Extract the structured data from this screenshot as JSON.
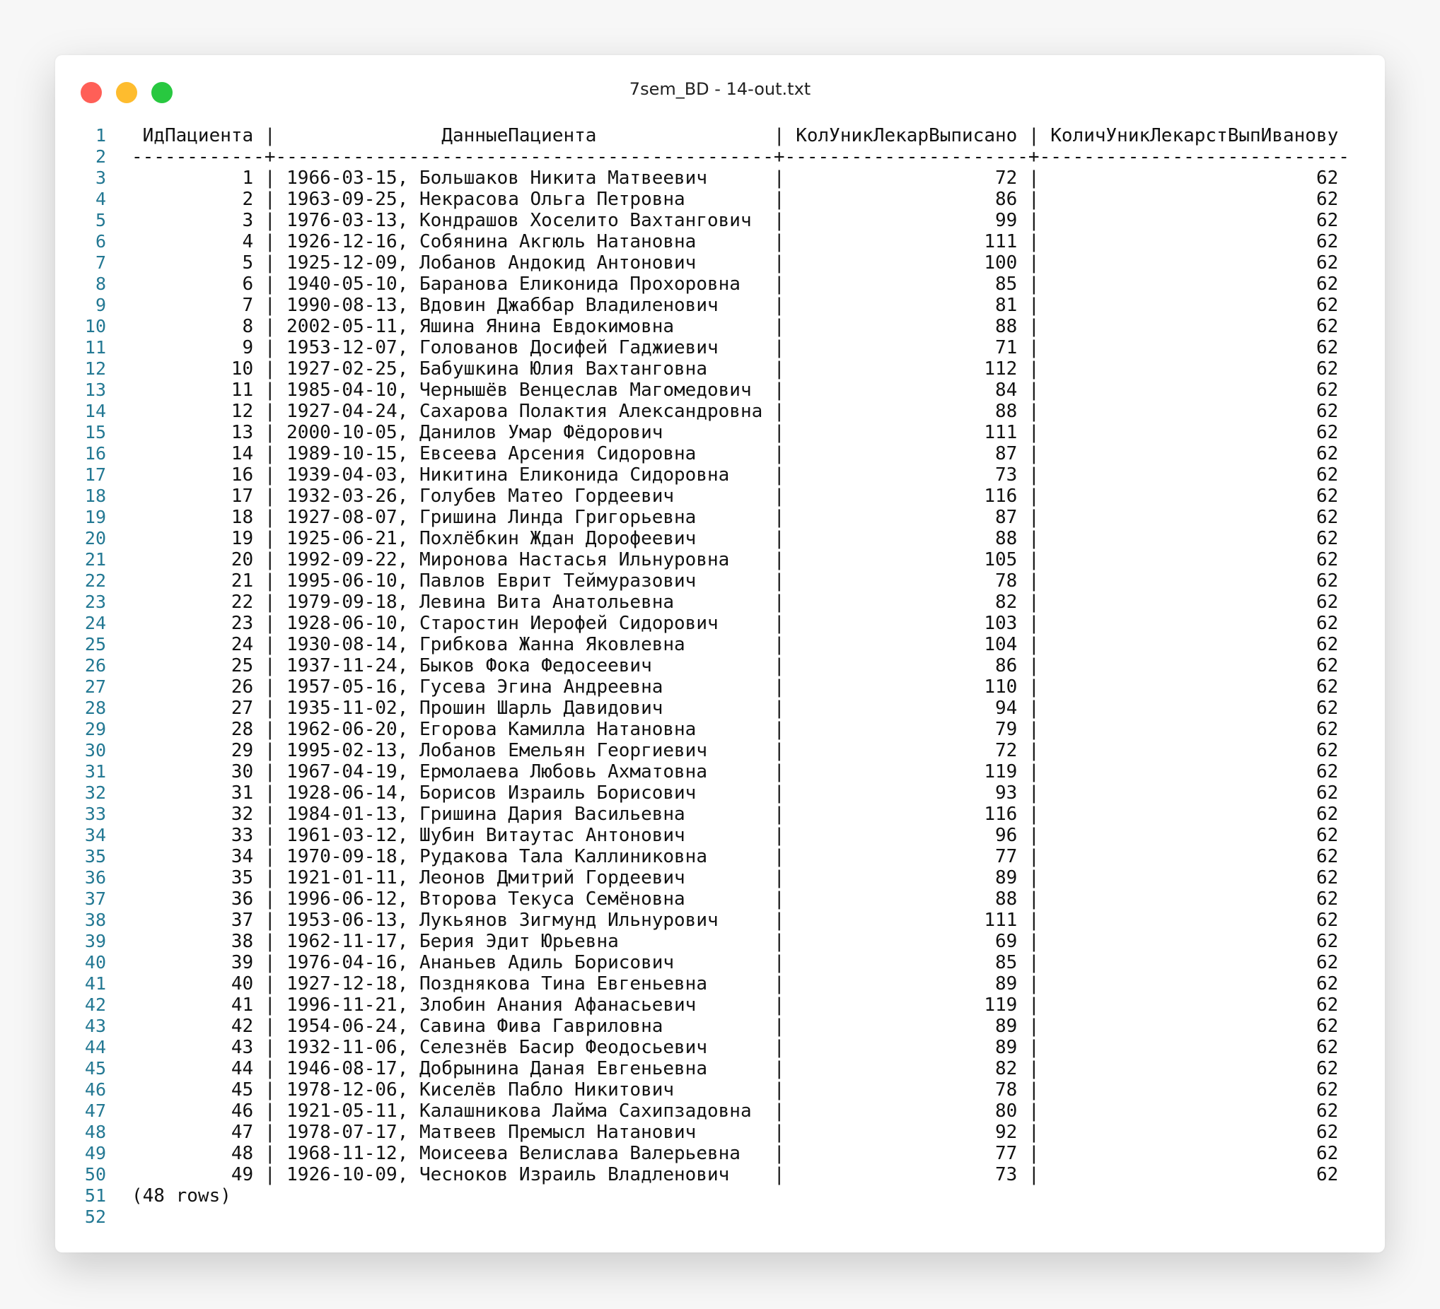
{
  "window": {
    "title": "7sem_BD - 14-out.txt",
    "buttons": {
      "close_color": "#ff5f57",
      "minimize_color": "#febc2e",
      "maximize_color": "#28c840"
    }
  },
  "editor": {
    "line_number_color": "#237893",
    "headers": [
      "ИдПациента",
      "ДанныеПациента",
      "КолУникЛекарВыписано",
      "КоличУникЛекарстВыпИванову"
    ],
    "rows": [
      [
        "1",
        "1966-03-15, Большаков Никита Матвеевич",
        "72",
        "62"
      ],
      [
        "2",
        "1963-09-25, Некрасова Ольга Петровна",
        "86",
        "62"
      ],
      [
        "3",
        "1976-03-13, Кондрашов Хоселито Вахтангович",
        "99",
        "62"
      ],
      [
        "4",
        "1926-12-16, Собянина Акгюль Натановна",
        "111",
        "62"
      ],
      [
        "5",
        "1925-12-09, Лобанов Андокид Антонович",
        "100",
        "62"
      ],
      [
        "6",
        "1940-05-10, Баранова Еликонида Прохоровна",
        "85",
        "62"
      ],
      [
        "7",
        "1990-08-13, Вдовин Джаббар Владиленович",
        "81",
        "62"
      ],
      [
        "8",
        "2002-05-11, Яшина Янина Евдокимовна",
        "88",
        "62"
      ],
      [
        "9",
        "1953-12-07, Голованов Досифей Гаджиевич",
        "71",
        "62"
      ],
      [
        "10",
        "1927-02-25, Бабушкина Юлия Вахтанговна",
        "112",
        "62"
      ],
      [
        "11",
        "1985-04-10, Чернышёв Венцеслав Магомедович",
        "84",
        "62"
      ],
      [
        "12",
        "1927-04-24, Сахарова Полактия Александровна",
        "88",
        "62"
      ],
      [
        "13",
        "2000-10-05, Данилов Умар Фёдорович",
        "111",
        "62"
      ],
      [
        "14",
        "1989-10-15, Евсеева Арсения Сидоровна",
        "87",
        "62"
      ],
      [
        "16",
        "1939-04-03, Никитина Еликонида Сидоровна",
        "73",
        "62"
      ],
      [
        "17",
        "1932-03-26, Голубев Матео Гордеевич",
        "116",
        "62"
      ],
      [
        "18",
        "1927-08-07, Гришина Линда Григорьевна",
        "87",
        "62"
      ],
      [
        "19",
        "1925-06-21, Похлёбкин Ждан Дорофеевич",
        "88",
        "62"
      ],
      [
        "20",
        "1992-09-22, Миронова Настасья Ильнуровна",
        "105",
        "62"
      ],
      [
        "21",
        "1995-06-10, Павлов Еврит Теймуразович",
        "78",
        "62"
      ],
      [
        "22",
        "1979-09-18, Левина Вита Анатольевна",
        "82",
        "62"
      ],
      [
        "23",
        "1928-06-10, Старостин Иерофей Сидорович",
        "103",
        "62"
      ],
      [
        "24",
        "1930-08-14, Грибкова Жанна Яковлевна",
        "104",
        "62"
      ],
      [
        "25",
        "1937-11-24, Быков Фока Федосеевич",
        "86",
        "62"
      ],
      [
        "26",
        "1957-05-16, Гусева Эгина Андреевна",
        "110",
        "62"
      ],
      [
        "27",
        "1935-11-02, Прошин Шарль Давидович",
        "94",
        "62"
      ],
      [
        "28",
        "1962-06-20, Егорова Камилла Натановна",
        "79",
        "62"
      ],
      [
        "29",
        "1995-02-13, Лобанов Емельян Георгиевич",
        "72",
        "62"
      ],
      [
        "30",
        "1967-04-19, Ермолаева Любовь Ахматовна",
        "119",
        "62"
      ],
      [
        "31",
        "1928-06-14, Борисов Израиль Борисович",
        "93",
        "62"
      ],
      [
        "32",
        "1984-01-13, Гришина Дария Васильевна",
        "116",
        "62"
      ],
      [
        "33",
        "1961-03-12, Шубин Витаутас Антонович",
        "96",
        "62"
      ],
      [
        "34",
        "1970-09-18, Рудакова Тала Каллиниковна",
        "77",
        "62"
      ],
      [
        "35",
        "1921-01-11, Леонов Дмитрий Гордеевич",
        "89",
        "62"
      ],
      [
        "36",
        "1996-06-12, Второва Текуса Семёновна",
        "88",
        "62"
      ],
      [
        "37",
        "1953-06-13, Лукьянов Зигмунд Ильнурович",
        "111",
        "62"
      ],
      [
        "38",
        "1962-11-17, Берия Эдит Юрьевна",
        "69",
        "62"
      ],
      [
        "39",
        "1976-04-16, Ананьев Адиль Борисович",
        "85",
        "62"
      ],
      [
        "40",
        "1927-12-18, Позднякова Тина Евгеньевна",
        "89",
        "62"
      ],
      [
        "41",
        "1996-11-21, Злобин Анания Афанасьевич",
        "119",
        "62"
      ],
      [
        "42",
        "1954-06-24, Савина Фива Гавриловна",
        "89",
        "62"
      ],
      [
        "43",
        "1932-11-06, Селезнёв Басир Феодосьевич",
        "89",
        "62"
      ],
      [
        "44",
        "1946-08-17, Добрынина Даная Евгеньевна",
        "82",
        "62"
      ],
      [
        "45",
        "1978-12-06, Киселёв Пабло Никитович",
        "78",
        "62"
      ],
      [
        "46",
        "1921-05-11, Калашникова Лайма Сахипзадовна",
        "80",
        "62"
      ],
      [
        "47",
        "1978-07-17, Матвеев Премысл Натанович",
        "92",
        "62"
      ],
      [
        "48",
        "1968-11-12, Моисеева Велислава Валерьевна",
        "77",
        "62"
      ],
      [
        "49",
        "1926-10-09, Чесноков Израиль Владленович",
        "73",
        "62"
      ]
    ],
    "footer": "(48 rows)"
  }
}
